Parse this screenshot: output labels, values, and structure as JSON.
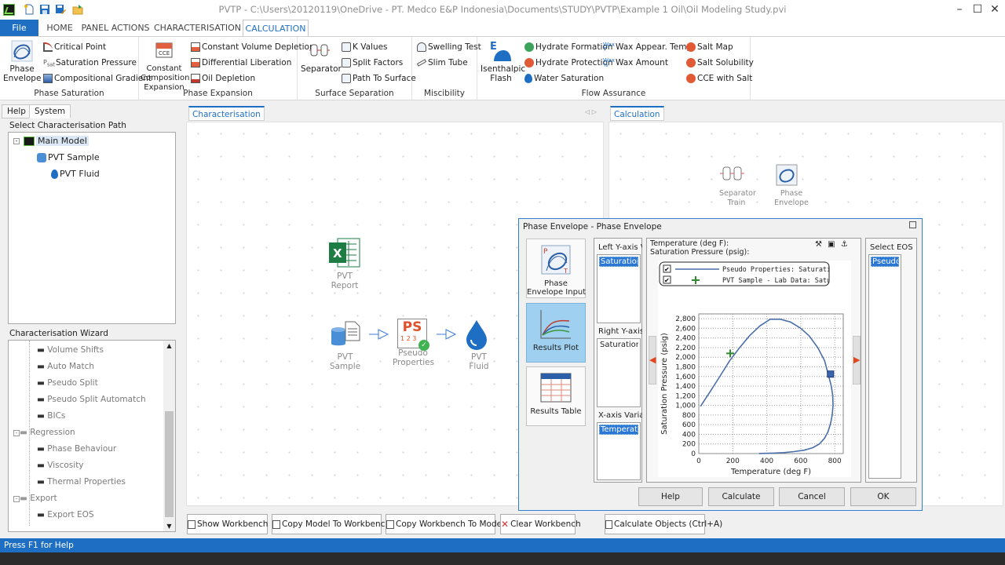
{
  "window": {
    "title": "PVTP - C:\\Users\\20120119\\OneDrive - PT. Medco E&P Indonesia\\Documents\\STUDY\\PVTP\\Example 1 Oil\\Oil Modeling Study.pvi"
  },
  "menu": {
    "file": "File",
    "tabs": [
      "HOME",
      "PANEL ACTIONS",
      "CHARACTERISATION",
      "CALCULATION"
    ]
  },
  "ribbon": {
    "phase_envelope": "Phase\nEnvelope",
    "critical_point": "Critical Point",
    "saturation_pressure": "Saturation Pressure",
    "compositional_gradient": "Compositional Gradient",
    "group_phase_saturation": "Phase Saturation",
    "cce": "Constant\nComposition\nExpansion",
    "constant_volume_depletion": "Constant Volume Depletion",
    "differential_liberation": "Differential Liberation",
    "oil_depletion": "Oil Depletion",
    "group_phase_expansion": "Phase Expansion",
    "separator": "Separator",
    "k_values": "K Values",
    "split_factors": "Split Factors",
    "path_to_surface": "Path To Surface",
    "group_surface_separation": "Surface Separation",
    "swelling_test": "Swelling Test",
    "slim_tube": "Slim Tube",
    "group_miscibility": "Miscibility",
    "isenthalpic_flash": "Isenthalpic\nFlash",
    "hydrate_formation": "Hydrate Formation",
    "hydrate_protection": "Hydrate Protection",
    "water_saturation": "Water Saturation",
    "wax_appear_temp": "Wax Appear. Temp.",
    "wax_amount": "Wax Amount",
    "salt_map": "Salt Map",
    "salt_solubility": "Salt Solubility",
    "cce_with_salt": "CCE with Salt",
    "group_flow_assurance": "Flow Assurance"
  },
  "left_panel": {
    "tabs": [
      "Help",
      "System"
    ],
    "path_title": "Select Characterisation Path",
    "tree": [
      "Main Model",
      "PVT Sample",
      "PVT Fluid"
    ],
    "wizard_title": "Characterisation Wizard",
    "wizard_items": [
      "Volume Shifts",
      "Auto Match",
      "Pseudo Split",
      "Pseudo Split Automatch",
      "BICs",
      "Regression",
      "Phase Behaviour",
      "Viscosity",
      "Thermal Properties",
      "Export",
      "Export EOS"
    ]
  },
  "characterisation": {
    "tab": "Characterisation",
    "report_label": "PVT\nReport",
    "sample_label": "PVT\nSample",
    "pseudo_label": "Pseudo\nProperties",
    "fluid_label": "PVT\nFluid",
    "pseudo_icon_text": "PS",
    "pseudo_icon_sub": "1 2 3"
  },
  "calculation": {
    "tab": "Calculation",
    "separator_label": "Separator\nTrain",
    "envelope_label": "Phase\nEnvelope"
  },
  "bottom_buttons": [
    "Show Workbench",
    "Copy Model To Workbench",
    "Copy Workbench To Model",
    "Clear Workbench",
    "Calculate Objects (Ctrl+A)"
  ],
  "status": "Press F1 for Help",
  "dialog": {
    "title": "Phase Envelope - Phase Envelope",
    "side_buttons": [
      "Phase\nEnvelope Input",
      "Results Plot",
      "Results Table"
    ],
    "left_y_label": "Left Y-axis Variable",
    "left_y_selected": "Saturation Pressure",
    "right_y_label": "Right Y-axis Variable",
    "right_y_item": "Saturation Pressure",
    "x_label": "X-axis Variable",
    "x_selected": "Temperature",
    "readout_1": "Temperature (deg F):",
    "readout_2": "Saturation Pressure (psig):",
    "select_eos": "Select EOS",
    "eos_selected": "Pseudo P",
    "buttons": [
      "Help",
      "Calculate",
      "Cancel",
      "OK"
    ]
  },
  "chart_data": {
    "type": "line",
    "xlabel": "Temperature (deg F)",
    "ylabel": "Saturation Pressure (psig)",
    "xlim": [
      0,
      850
    ],
    "ylim": [
      0,
      2900
    ],
    "xticks": [
      0,
      200,
      400,
      600,
      800
    ],
    "yticks": [
      0,
      200,
      400,
      600,
      800,
      1000,
      1200,
      1400,
      1600,
      1800,
      2000,
      2200,
      2400,
      2600,
      2800
    ],
    "grid": true,
    "legend_position": "top",
    "series": [
      {
        "name": "Pseudo Properties: Saturation",
        "style": "line",
        "color": "#4a6fa8",
        "x": [
          10,
          60,
          120,
          180,
          240,
          300,
          360,
          420,
          480,
          540,
          600,
          650,
          700,
          740,
          765,
          780,
          788,
          790,
          785,
          775,
          760,
          740,
          710,
          670,
          620,
          560,
          500,
          440,
          390,
          355
        ],
        "y": [
          980,
          1250,
          1580,
          1920,
          2200,
          2450,
          2650,
          2790,
          2790,
          2730,
          2600,
          2440,
          2200,
          1930,
          1600,
          1400,
          1200,
          1000,
          800,
          620,
          450,
          320,
          200,
          120,
          70,
          40,
          20,
          10,
          5,
          2
        ]
      },
      {
        "name": "PVT Sample - Lab Data: Saturation",
        "style": "marker",
        "color": "#2e8b2e",
        "x": [
          185
        ],
        "y": [
          2080
        ]
      }
    ],
    "critical_point": {
      "x": 775,
      "y": 1650
    }
  }
}
